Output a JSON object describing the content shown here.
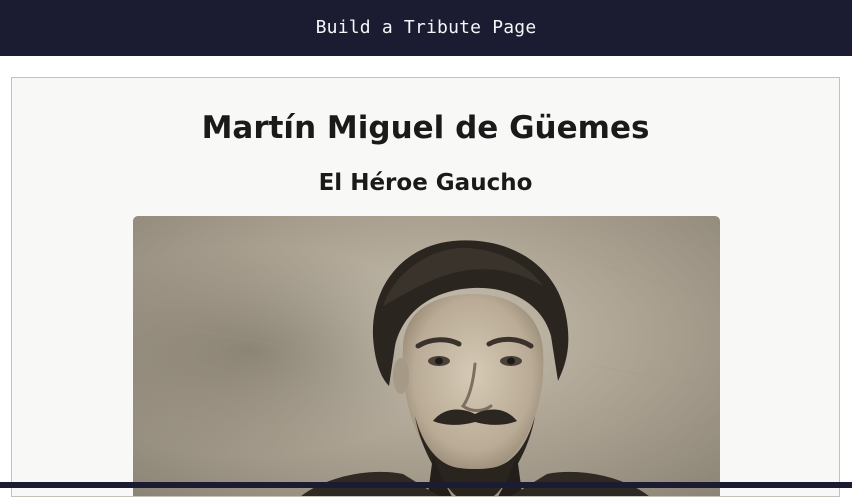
{
  "header": {
    "title": "Build a Tribute Page"
  },
  "tribute": {
    "title": "Martín Miguel de Güemes",
    "subtitle": "El Héroe Gaucho",
    "image_alt": "Portrait of Martín Miguel de Güemes"
  },
  "colors": {
    "header_bg": "#1b1b32",
    "header_text": "#f5f6f7",
    "preview_bg": "#f8f8f6",
    "preview_border": "#c5c1b8",
    "heading_text": "#1a1a1a"
  }
}
